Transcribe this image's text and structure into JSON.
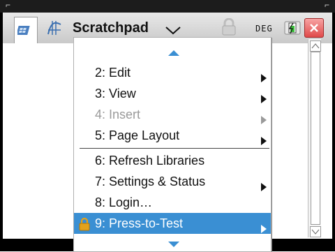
{
  "app": {
    "tab_title": "Scratchpad",
    "angle_mode": "DEG"
  },
  "menu": {
    "items": [
      {
        "label": "2: Edit",
        "has_submenu": true,
        "enabled": true,
        "selected": false
      },
      {
        "label": "3: View",
        "has_submenu": true,
        "enabled": true,
        "selected": false
      },
      {
        "label": "4: Insert",
        "has_submenu": true,
        "enabled": false,
        "selected": false
      },
      {
        "label": "5: Page Layout",
        "has_submenu": true,
        "enabled": true,
        "selected": false
      },
      {
        "label": "6: Refresh Libraries",
        "has_submenu": false,
        "enabled": true,
        "selected": false
      },
      {
        "label": "7: Settings & Status",
        "has_submenu": true,
        "enabled": true,
        "selected": false
      },
      {
        "label": "8: Login…",
        "has_submenu": false,
        "enabled": true,
        "selected": false
      },
      {
        "label": "9: Press-to-Test",
        "has_submenu": true,
        "enabled": true,
        "selected": true
      }
    ]
  },
  "colors": {
    "selection": "#3a8fd3",
    "close_button": "#e04a4a",
    "lock": "#e3a21a"
  },
  "icons": {
    "tab1": "calculator-scratchpad-icon",
    "tab2": "graph-scratchpad-icon",
    "header_lock": "lock-icon",
    "battery": "battery-icon",
    "close": "close-icon",
    "menu_up": "scroll-up-arrow-icon",
    "menu_down": "scroll-down-arrow-icon",
    "item_lock": "lock-icon"
  }
}
